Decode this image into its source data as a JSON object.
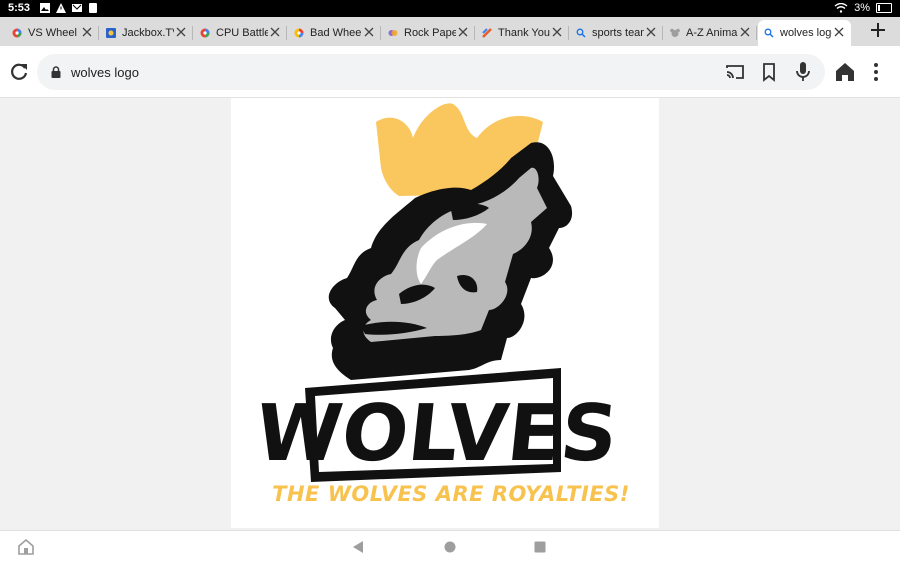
{
  "status_bar": {
    "time": "5:53",
    "battery": "3%"
  },
  "tabs": [
    {
      "title": "VS Wheel",
      "favicon": "wheel-favicon",
      "active": false
    },
    {
      "title": "Jackbox.TV",
      "favicon": "jackbox-favicon",
      "active": false
    },
    {
      "title": "CPU Battle",
      "favicon": "wheel-favicon",
      "active": false
    },
    {
      "title": "Bad Wheel",
      "favicon": "wheel-favicon",
      "active": false
    },
    {
      "title": "Rock Paper",
      "favicon": "rps-favicon",
      "active": false
    },
    {
      "title": "Thank You!",
      "favicon": "thankyou-favicon",
      "active": false
    },
    {
      "title": "sports team",
      "favicon": "search-favicon",
      "active": false
    },
    {
      "title": "A-Z Animal",
      "favicon": "animal-favicon",
      "active": false
    },
    {
      "title": "wolves logo",
      "favicon": "search-favicon",
      "active": true
    }
  ],
  "toolbar": {
    "omnibox_text": "wolves logo"
  },
  "content": {
    "logo_wordmark": "WOLVES",
    "logo_tagline": "THE WOLVES ARE ROYALTIES!"
  },
  "colors": {
    "crown": "#f8c24f",
    "tagline": "#f8c24f",
    "wolf_gray": "#b9b9b9",
    "accent_blue": "#1a73e8"
  }
}
